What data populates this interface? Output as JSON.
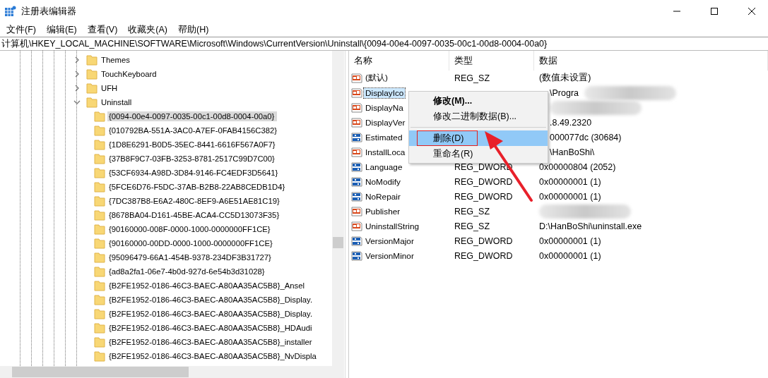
{
  "window": {
    "title": "注册表编辑器"
  },
  "menu": [
    "文件(F)",
    "编辑(E)",
    "查看(V)",
    "收藏夹(A)",
    "帮助(H)"
  ],
  "address": "计算机\\HKEY_LOCAL_MACHINE\\SOFTWARE\\Microsoft\\Windows\\CurrentVersion\\Uninstall\\{0094-00e4-0097-0035-00c1-00d8-0004-00a0}",
  "tree": [
    {
      "label": "Themes",
      "expanded": false,
      "selected": false
    },
    {
      "label": "TouchKeyboard",
      "expanded": false,
      "selected": false
    },
    {
      "label": "UFH",
      "expanded": false,
      "selected": false
    },
    {
      "label": "Uninstall",
      "expanded": true,
      "selected": false,
      "children": [
        {
          "label": "{0094-00e4-0097-0035-00c1-00d8-0004-00a0}",
          "selected": true
        },
        {
          "label": "{010792BA-551A-3AC0-A7EF-0FAB4156C382}",
          "selected": false
        },
        {
          "label": "{1D8E6291-B0D5-35EC-8441-6616F567A0F7}",
          "selected": false
        },
        {
          "label": "{37B8F9C7-03FB-3253-8781-2517C99D7C00}",
          "selected": false
        },
        {
          "label": "{53CF6934-A98D-3D84-9146-FC4EDF3D5641}",
          "selected": false
        },
        {
          "label": "{5FCE6D76-F5DC-37AB-B2B8-22AB8CEDB1D4}",
          "selected": false
        },
        {
          "label": "{7DC387B8-E6A2-480C-8EF9-A6E51AE81C19}",
          "selected": false
        },
        {
          "label": "{8678BA04-D161-45BE-ACA4-CC5D13073F35}",
          "selected": false
        },
        {
          "label": "{90160000-008F-0000-1000-0000000FF1CE}",
          "selected": false
        },
        {
          "label": "{90160000-00DD-0000-1000-0000000FF1CE}",
          "selected": false
        },
        {
          "label": "{95096479-66A1-454B-9378-234DF3B31727}",
          "selected": false
        },
        {
          "label": "{ad8a2fa1-06e7-4b0d-927d-6e54b3d31028}",
          "selected": false
        },
        {
          "label": "{B2FE1952-0186-46C3-BAEC-A80AA35AC5B8}_Ansel",
          "selected": false
        },
        {
          "label": "{B2FE1952-0186-46C3-BAEC-A80AA35AC5B8}_Display.",
          "selected": false
        },
        {
          "label": "{B2FE1952-0186-46C3-BAEC-A80AA35AC5B8}_Display.",
          "selected": false
        },
        {
          "label": "{B2FE1952-0186-46C3-BAEC-A80AA35AC5B8}_HDAudi",
          "selected": false
        },
        {
          "label": "{B2FE1952-0186-46C3-BAEC-A80AA35AC5B8}_installer",
          "selected": false
        },
        {
          "label": "{B2FE1952-0186-46C3-BAEC-A80AA35AC5B8}_NvDispla",
          "selected": false
        }
      ]
    }
  ],
  "columns": [
    "名称",
    "类型",
    "数据"
  ],
  "values": [
    {
      "kind": "string",
      "name": "(默认)",
      "type": "REG_SZ",
      "data": "(数值未设置)",
      "selected": false,
      "blurred": false
    },
    {
      "kind": "string",
      "name": "DisplayIco",
      "data": "\\Progra",
      "selected": true,
      "blurred": true
    },
    {
      "kind": "string",
      "name": "DisplayNa",
      "selected": false,
      "blurred": true
    },
    {
      "kind": "string",
      "name": "DisplayVer",
      "data": ".8.49.2320",
      "selected": false,
      "blurred": false
    },
    {
      "kind": "number",
      "name": "Estimated",
      "data": "000077dc (30684)",
      "selected": false,
      "blurred": false
    },
    {
      "kind": "string",
      "name": "InstallLoca",
      "data": "\\HanBoShi\\",
      "selected": false,
      "blurred": false
    },
    {
      "kind": "number",
      "name": "Language",
      "type": "REG_DWORD",
      "data": "0x00000804 (2052)",
      "selected": false,
      "blurred": false
    },
    {
      "kind": "number",
      "name": "NoModify",
      "type": "REG_DWORD",
      "data": "0x00000001 (1)",
      "selected": false,
      "blurred": false
    },
    {
      "kind": "number",
      "name": "NoRepair",
      "type": "REG_DWORD",
      "data": "0x00000001 (1)",
      "selected": false,
      "blurred": false
    },
    {
      "kind": "string",
      "name": "Publisher",
      "type": "REG_SZ",
      "selected": false,
      "blurred": true
    },
    {
      "kind": "string",
      "name": "UninstallString",
      "type": "REG_SZ",
      "data": "D:\\HanBoShi\\uninstall.exe",
      "selected": false,
      "blurred": false
    },
    {
      "kind": "number",
      "name": "VersionMajor",
      "type": "REG_DWORD",
      "data": "0x00000001 (1)",
      "selected": false,
      "blurred": false
    },
    {
      "kind": "number",
      "name": "VersionMinor",
      "type": "REG_DWORD",
      "data": "0x00000001 (1)",
      "selected": false,
      "blurred": false
    }
  ],
  "context_menu": [
    {
      "kind": "item",
      "label": "修改(M)...",
      "default": true,
      "selected": false
    },
    {
      "kind": "item",
      "label": "修改二进制数据(B)...",
      "default": false,
      "selected": false
    },
    {
      "kind": "separator"
    },
    {
      "kind": "item",
      "label": "删除(D)",
      "default": false,
      "selected": true
    },
    {
      "kind": "item",
      "label": "重命名(R)",
      "default": false,
      "selected": false
    }
  ]
}
